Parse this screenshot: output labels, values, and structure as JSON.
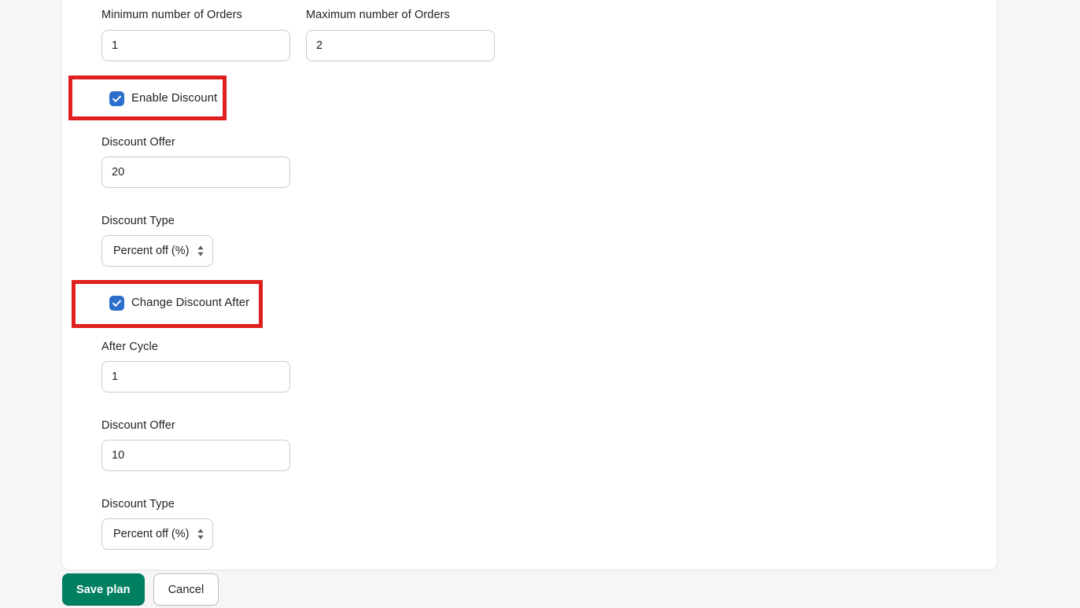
{
  "form": {
    "orders_row": {
      "min_orders": {
        "label": "Minimum number of Orders",
        "value": "1"
      },
      "max_orders": {
        "label": "Maximum number of Orders",
        "value": "2"
      }
    },
    "enable_discount": {
      "label": "Enable Discount",
      "checked": true,
      "highlighted": true
    },
    "discount_offer_1": {
      "label": "Discount Offer",
      "value": "20"
    },
    "discount_type_1": {
      "label": "Discount Type",
      "value": "Percent off (%)"
    },
    "change_discount_after": {
      "label": "Change Discount After",
      "checked": true,
      "highlighted": true
    },
    "after_cycle": {
      "label": "After Cycle",
      "value": "1"
    },
    "discount_offer_2": {
      "label": "Discount Offer",
      "value": "10"
    },
    "discount_type_2": {
      "label": "Discount Type",
      "value": "Percent off (%)"
    }
  },
  "footer": {
    "save_label": "Save plan",
    "cancel_label": "Cancel"
  },
  "icons": {
    "checkmark": "check-icon",
    "select_arrows": "chevron-up-down-icon"
  },
  "colors": {
    "page_background": "#f6f6f7",
    "card_background": "#ffffff",
    "checkbox_blue": "#2c6ecb",
    "primary_button_green": "#008060",
    "annotation_red": "#e02020",
    "input_border": "#c9cccf",
    "text": "#202223"
  }
}
